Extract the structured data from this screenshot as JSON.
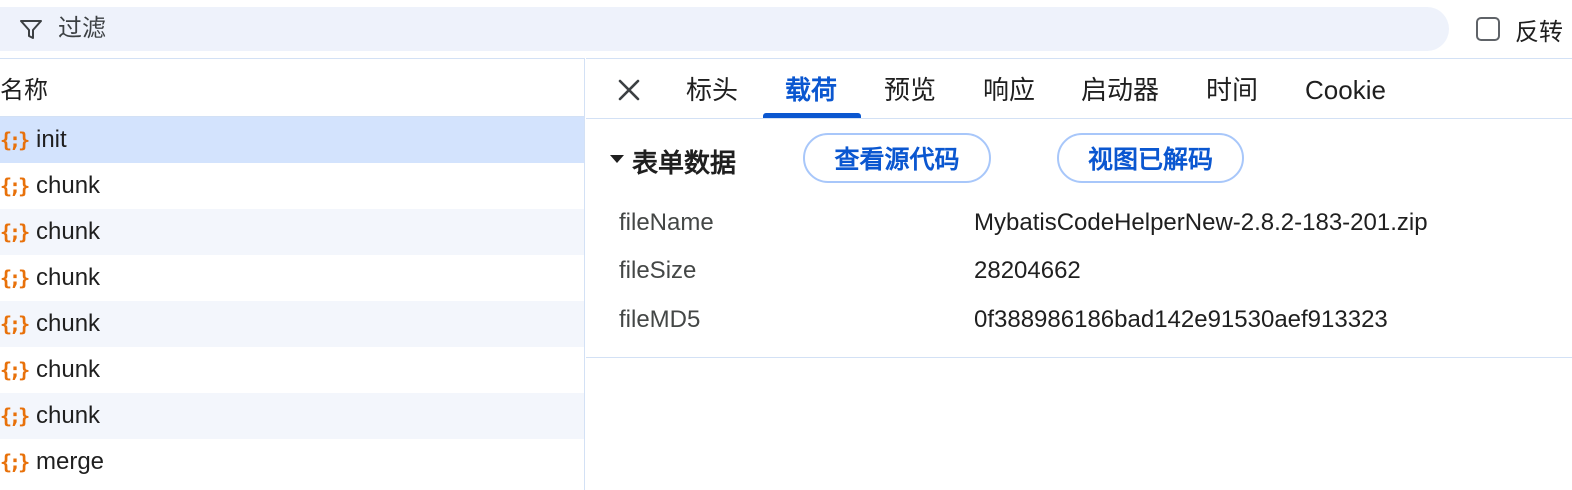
{
  "filter": {
    "placeholder": "过滤",
    "invert_label": "反转"
  },
  "requests": {
    "column_header": "名称",
    "items": [
      {
        "name": "init",
        "icon": "json-braces-icon"
      },
      {
        "name": "chunk",
        "icon": "json-braces-icon"
      },
      {
        "name": "chunk",
        "icon": "json-braces-icon"
      },
      {
        "name": "chunk",
        "icon": "json-braces-icon"
      },
      {
        "name": "chunk",
        "icon": "json-braces-icon"
      },
      {
        "name": "chunk",
        "icon": "json-braces-icon"
      },
      {
        "name": "chunk",
        "icon": "json-braces-icon"
      },
      {
        "name": "merge",
        "icon": "json-braces-icon"
      }
    ]
  },
  "detail": {
    "tabs": [
      {
        "label": "标头"
      },
      {
        "label": "载荷",
        "active": true
      },
      {
        "label": "预览"
      },
      {
        "label": "响应"
      },
      {
        "label": "启动器"
      },
      {
        "label": "时间"
      },
      {
        "label": "Cookie"
      }
    ],
    "section_title": "表单数据",
    "view_source_label": "查看源代码",
    "view_decoded_label": "视图已解码",
    "form_data": [
      {
        "key": "fileName",
        "value": "MybatisCodeHelperNew-2.8.2-183-201.zip"
      },
      {
        "key": "fileSize",
        "value": "28204662"
      },
      {
        "key": "fileMD5",
        "value": "0f388986186bad142e91530aef913323"
      }
    ]
  },
  "colors": {
    "accent": "#0b57d0",
    "selected_row": "#d3e3fd",
    "icon_orange": "#e8710a"
  }
}
